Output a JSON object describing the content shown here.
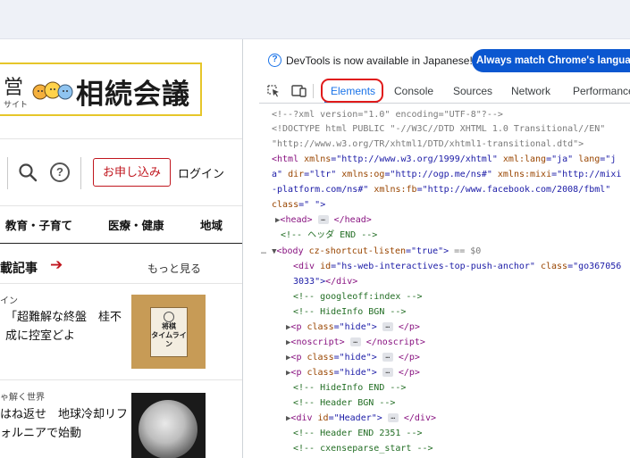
{
  "web": {
    "logo_ei": "営",
    "logo_site": "サイト",
    "logo_title": "相続会議",
    "apply_label": "お申し込み",
    "login_label": "ログイン",
    "help_glyph": "?",
    "nav": [
      "教育・子育て",
      "医療・健康",
      "地域"
    ],
    "section_title": "載記事",
    "section_arrow": "➔",
    "more_label": "もっと見る",
    "article1": {
      "tag": "イン",
      "text": "「超難解な終盤　桂不成に控室どよ"
    },
    "thumb1_text": "将棋\nタイムライン",
    "article2": {
      "tag": "ゃ解く世界",
      "text": "はね返せ　地球冷却リフォルニアで始動"
    }
  },
  "devtools": {
    "info_icon": "?",
    "info_text": "DevTools is now available in Japanese!",
    "match_button": "Always match Chrome's language",
    "tabs": [
      "Elements",
      "Console",
      "Sources",
      "Network",
      "Performance"
    ],
    "active_tab": "Elements",
    "lines": {
      "l1": "<!--?xml version=\"1.0\" encoding=\"UTF-8\"?-->",
      "l2": "<!DOCTYPE html PUBLIC \"-//W3C//DTD XHTML 1.0 Transitional//EN\"",
      "l3": "\"http://www.w3.org/TR/xhtml1/DTD/xhtml1-transitional.dtd\">",
      "l4a": "<html",
      "l4b": " xmlns",
      "l4c": "=\"http://www.w3.org/1999/xhtml\"",
      "l4d": " xml:lang",
      "l4e": "=\"ja\"",
      "l4f": " lang",
      "l4g": "=\"j",
      "l5a": "a\"",
      "l5b": " dir",
      "l5c": "=\"ltr\"",
      "l5d": " xmlns:og",
      "l5e": "=\"http://ogp.me/ns#\"",
      "l5f": " xmlns:mixi",
      "l5g": "=\"http://mixi",
      "l6a": "-platform.com/ns#\"",
      "l6b": " xmlns:fb",
      "l6c": "=\"http://www.facebook.com/2008/fbml\"",
      "l7a": "class",
      "l7b": "=\" \">",
      "l8": "<head>",
      "l8b": "</head>",
      "l9": "<!-- ヘッダ END -->",
      "l10a": "<body",
      "l10b": " cz-shortcut-listen",
      "l10c": "=\"true\">",
      "l10d": " == $0",
      "l11a": "<div",
      "l11b": " id",
      "l11c": "=\"hs-web-interactives-top-push-anchor\"",
      "l11d": " class",
      "l11e": "=\"go367056",
      "l12a": "3033\">",
      "l12b": "</div>",
      "l13": "<!-- googleoff:index -->",
      "l14": "<!-- HideInfo BGN -->",
      "l15a": "<p",
      "l15b": " class",
      "l15c": "=\"hide\">",
      "l15d": "</p>",
      "l16a": "<noscript>",
      "l16b": "</noscript>",
      "l17a": "<p",
      "l17b": " class",
      "l17c": "=\"hide\">",
      "l17d": "</p>",
      "l18a": "<p",
      "l18b": " class",
      "l18c": "=\"hide\">",
      "l18d": "</p>",
      "l19": "<!-- HideInfo END -->",
      "l20": "<!-- Header BGN -->",
      "l21a": "<div",
      "l21b": " id",
      "l21c": "=\"Header\">",
      "l21d": "</div>",
      "l22": "<!-- Header END 2351 -->",
      "l23": "<!-- cxenseparse_start -->"
    },
    "ellipsis": "…",
    "row_dots": "…",
    "triangle_right": "▶",
    "triangle_down": "▼"
  },
  "colors": {
    "accent_red": "#c0161e",
    "devtools_blue": "#1a73e8",
    "highlight_red": "#e01a1a"
  }
}
